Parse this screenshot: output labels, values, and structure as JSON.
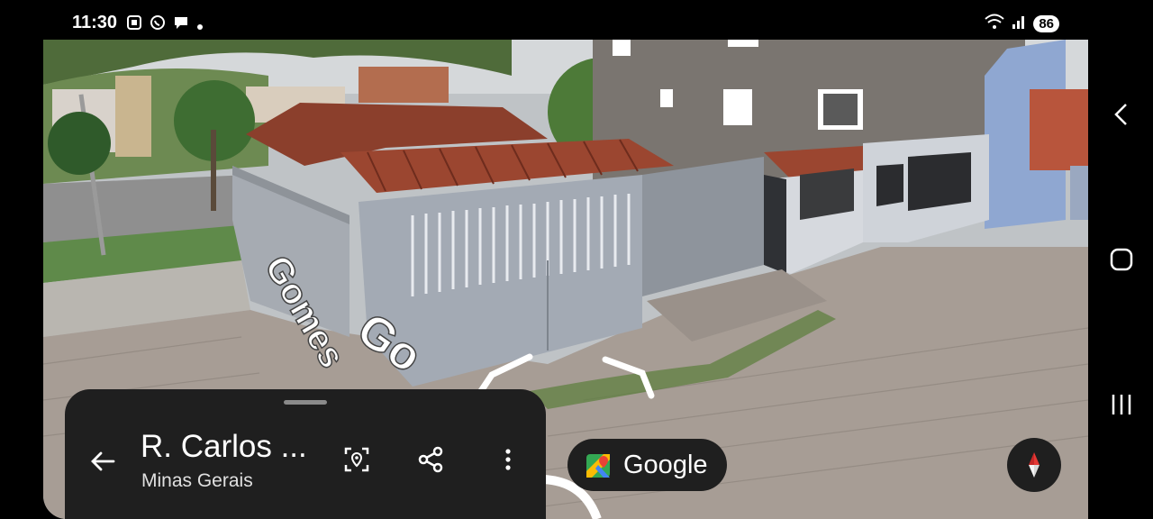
{
  "status_bar": {
    "time": "11:30",
    "battery": "86",
    "icons": [
      "screenshot-icon",
      "whatsapp-icon",
      "chat-bubble-icon",
      "dot-icon",
      "wifi-icon",
      "signal-icon"
    ]
  },
  "street_labels": {
    "curved_text_1": "Gomes",
    "curved_text_2": "Go"
  },
  "place_card": {
    "title": "R. Carlos ...",
    "subtitle": "Minas Gerais",
    "actions": [
      "photo-location-icon",
      "share-icon",
      "more-vert-icon"
    ]
  },
  "google_badge": {
    "label": "Google"
  },
  "colors": {
    "card_bg": "#1f1f1f",
    "roof_tile": "#8b3f2c",
    "wall_grey": "#9aa0a8",
    "gate_blue_grey": "#a3aab4",
    "pavement": "#a79d95",
    "compass_red": "#e53935"
  }
}
